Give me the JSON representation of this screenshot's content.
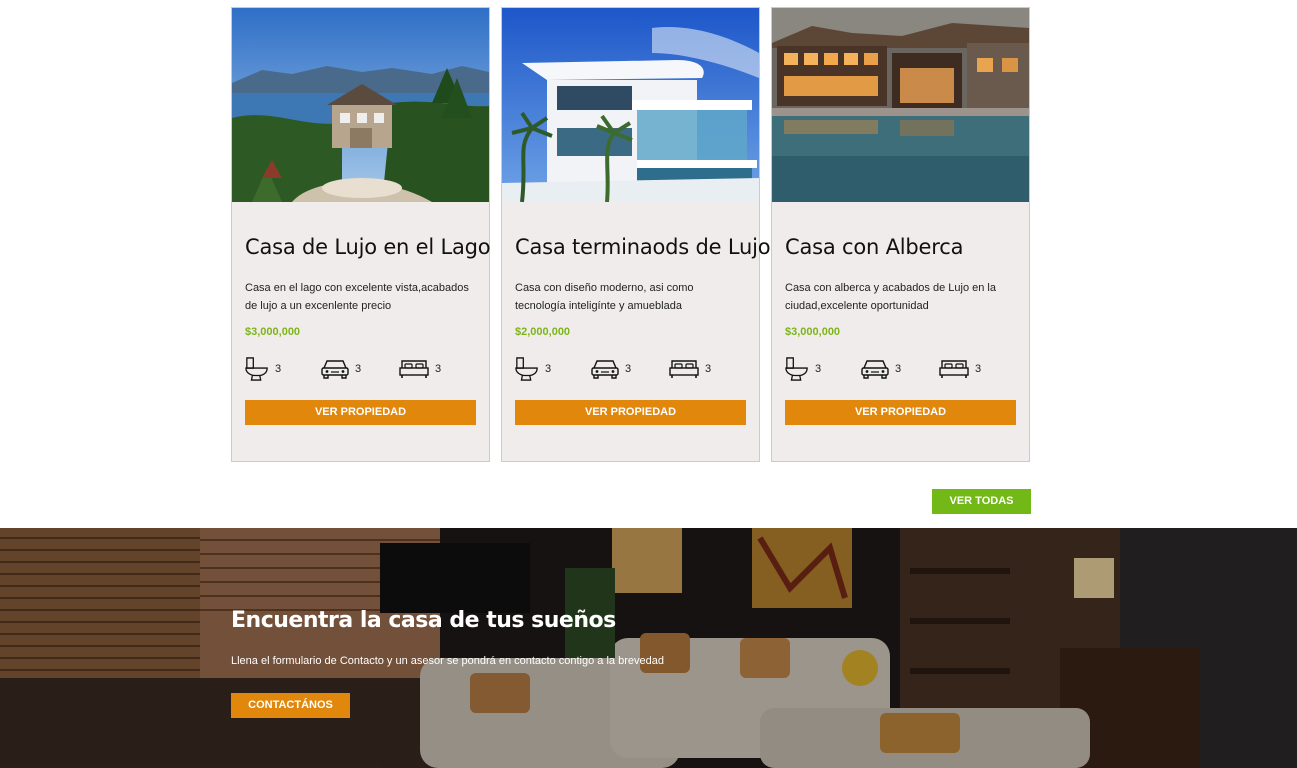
{
  "properties": [
    {
      "title": "Casa de Lujo en el Lago",
      "description": "Casa en el lago con excelente vista,acabados de lujo a un excenlente precio",
      "price": "$3,000,000",
      "bathrooms": "3",
      "garage": "3",
      "bedrooms": "3",
      "button": "VER PROPIEDAD"
    },
    {
      "title": "Casa terminaods de Lujo",
      "description": "Casa con diseño moderno, asi como tecnología inteligínte y amueblada",
      "price": "$2,000,000",
      "bathrooms": "3",
      "garage": "3",
      "bedrooms": "3",
      "button": "VER PROPIEDAD"
    },
    {
      "title": "Casa con Alberca",
      "description": "Casa con alberca y acabados de Lujo en la ciudad,excelente oportunidad",
      "price": "$3,000,000",
      "bathrooms": "3",
      "garage": "3",
      "bedrooms": "3",
      "button": "VER PROPIEDAD"
    }
  ],
  "see_all_label": "VER TODAS",
  "hero": {
    "title": "Encuentra la casa de tus sueños",
    "text": "Llena el formulario de Contacto y un asesor se pondrá en contacto contigo a la brevedad",
    "button": "CONTACTÁNOS"
  },
  "colors": {
    "accent_orange": "#e0870c",
    "accent_green": "#72b817",
    "price_green": "#7cb518",
    "card_bg": "#f1ecec"
  },
  "icons": [
    "toilet-icon",
    "car-icon",
    "bed-icon"
  ]
}
